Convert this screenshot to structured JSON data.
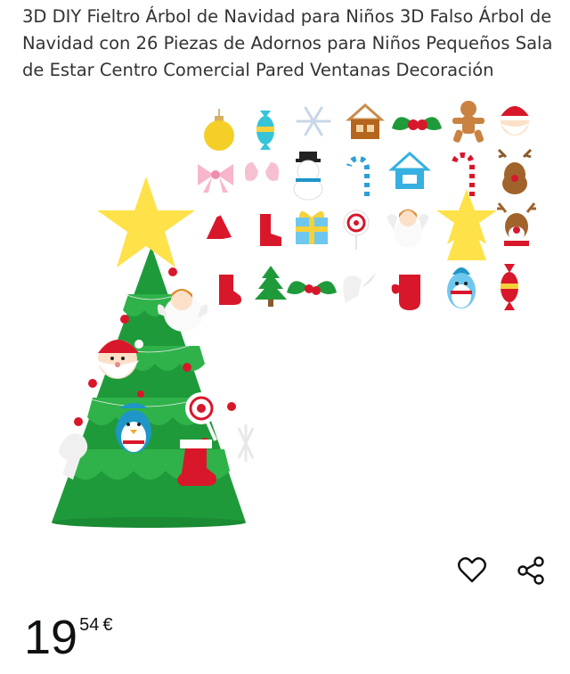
{
  "product": {
    "title": "3D DIY Fieltro Árbol de Navidad para Niños 3D Falso Árbol de Navidad con 26 Piezas de Adornos para Niños Pequeños Sala de Estar Centro Comercial Pared Ventanas Decoración",
    "image_alt": "Árbol de navidad de fieltro con adornos"
  },
  "actions": {
    "favorite_icon": "heart-icon",
    "share_icon": "share-icon"
  },
  "price": {
    "whole": "19",
    "fraction": "54",
    "currency": "€"
  },
  "colors": {
    "tree_green": "#1f9a3a",
    "tree_dark": "#157a2c",
    "star_yellow": "#ffe14a",
    "ornament_red": "#d8172b",
    "text": "#333333"
  }
}
